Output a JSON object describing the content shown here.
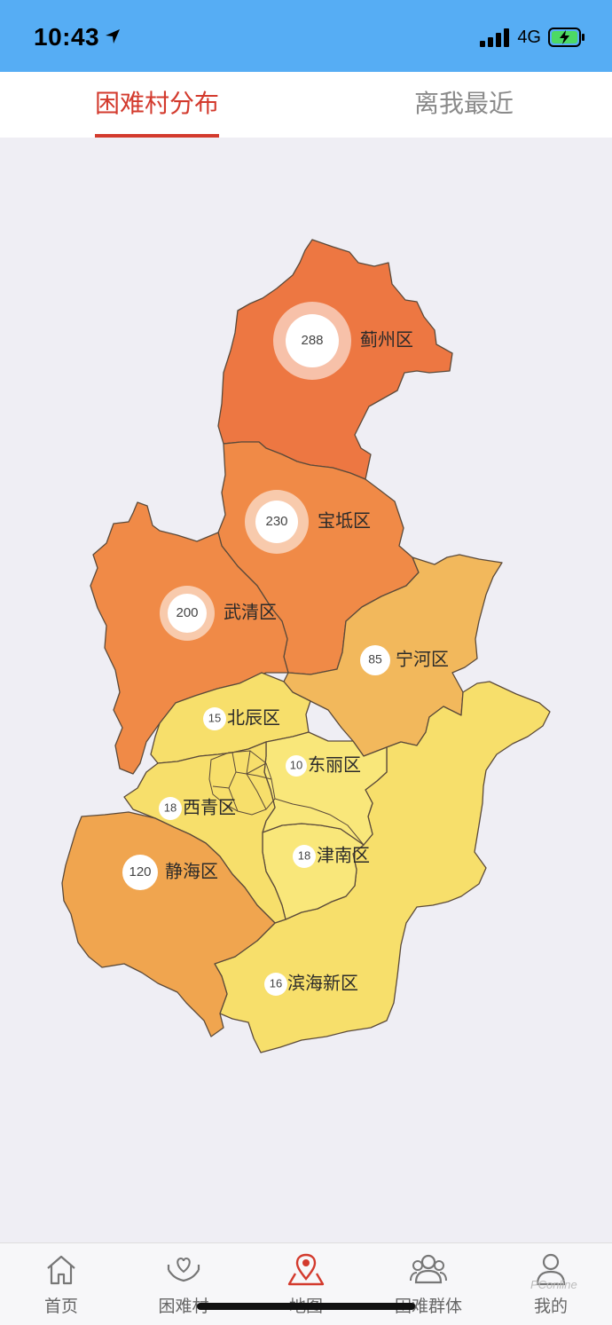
{
  "status_bar": {
    "time": "10:43",
    "network": "4G"
  },
  "tabs": [
    {
      "label": "困难村分布",
      "active": true
    },
    {
      "label": "离我最近",
      "active": false
    }
  ],
  "map": {
    "colors": {
      "high": "#ed7742",
      "mid": "#f08a47",
      "mid_low": "#f2b85c",
      "low": "#f7df6b",
      "lowest": "#f9e77a"
    },
    "districts": [
      {
        "name": "蓟州区",
        "count": "288"
      },
      {
        "name": "宝坻区",
        "count": "230"
      },
      {
        "name": "武清区",
        "count": "200"
      },
      {
        "name": "宁河区",
        "count": "85"
      },
      {
        "name": "北辰区",
        "count": "15"
      },
      {
        "name": "东丽区",
        "count": "10"
      },
      {
        "name": "西青区",
        "count": "18"
      },
      {
        "name": "津南区",
        "count": "18"
      },
      {
        "name": "静海区",
        "count": "120"
      },
      {
        "name": "滨海新区",
        "count": "16"
      }
    ]
  },
  "bottom_nav": [
    {
      "label": "首页",
      "icon": "home-icon",
      "active": false
    },
    {
      "label": "困难村",
      "icon": "village-care-icon",
      "active": false
    },
    {
      "label": "地图",
      "icon": "map-pin-icon",
      "active": true
    },
    {
      "label": "困难群体",
      "icon": "group-icon",
      "active": false
    },
    {
      "label": "我的",
      "icon": "user-icon",
      "active": false
    }
  ],
  "watermark": "PConline"
}
